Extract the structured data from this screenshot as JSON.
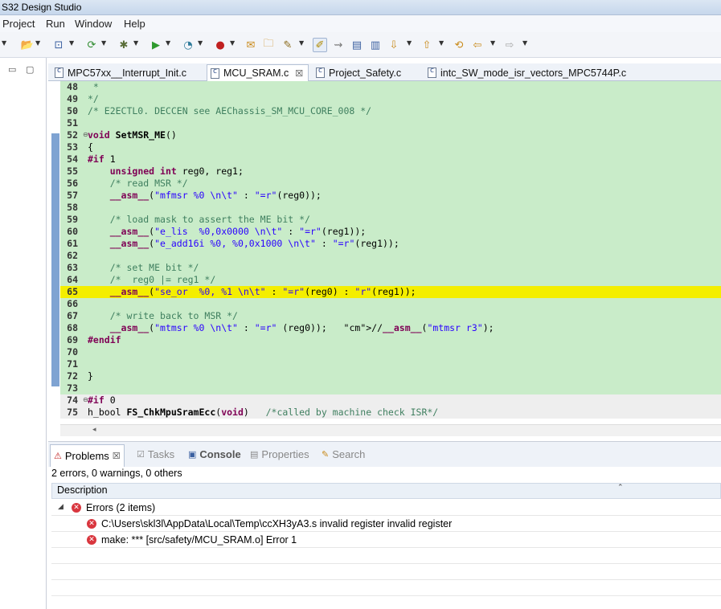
{
  "window": {
    "title": "S32 Design Studio"
  },
  "menu": [
    "Project",
    "Run",
    "Window",
    "Help"
  ],
  "toolbar_icons": [
    "new-file-icon",
    "open-folder-icon",
    "new-class-icon",
    "refresh-icon",
    "debug-icon",
    "run-icon",
    "profile-icon",
    "stop-icon",
    "open-type-icon",
    "folder-icon",
    "pen-icon",
    "highlight-icon",
    "link-icon",
    "column-icon",
    "next-annotation-icon",
    "prev-annotation-icon",
    "back-icon",
    "forward-icon"
  ],
  "tabs": [
    {
      "label": "MPC57xx__Interrupt_Init.c",
      "active": false
    },
    {
      "label": "MCU_SRAM.c",
      "active": true,
      "close": "☒"
    },
    {
      "label": "Project_Safety.c",
      "active": false
    },
    {
      "label": "intc_SW_mode_isr_vectors_MPC5744P.c",
      "active": false
    }
  ],
  "code_lines": [
    {
      "n": "48",
      "t": " *"
    },
    {
      "n": "49",
      "t": "*/"
    },
    {
      "n": "50",
      "t": "/* E2ECTL0. DECCEN see AEChassis_SM_MCU_CORE_008 */"
    },
    {
      "n": "51",
      "t": ""
    },
    {
      "n": "52",
      "t": "void SetMSR_ME()"
    },
    {
      "n": "53",
      "t": "{"
    },
    {
      "n": "54",
      "t": "#if 1"
    },
    {
      "n": "55",
      "t": "    unsigned int reg0, reg1;"
    },
    {
      "n": "56",
      "t": "    /* read MSR */"
    },
    {
      "n": "57",
      "t": "    __asm__(\"mfmsr %0 \\n\\t\" : \"=r\"(reg0));"
    },
    {
      "n": "58",
      "t": ""
    },
    {
      "n": "59",
      "t": "    /* load mask to assert the ME bit */"
    },
    {
      "n": "60",
      "t": "    __asm__(\"e_lis  %0,0x0000 \\n\\t\" : \"=r\"(reg1));"
    },
    {
      "n": "61",
      "t": "    __asm__(\"e_add16i %0, %0,0x1000 \\n\\t\" : \"=r\"(reg1));"
    },
    {
      "n": "62",
      "t": ""
    },
    {
      "n": "63",
      "t": "    /* set ME bit */"
    },
    {
      "n": "64",
      "t": "    /*  reg0 |= reg1 */"
    },
    {
      "n": "65",
      "t": "    __asm__(\"se_or  %0, %1 \\n\\t\" : \"=r\"(reg0) : \"r\"(reg1));"
    },
    {
      "n": "66",
      "t": ""
    },
    {
      "n": "67",
      "t": "    /* write back to MSR */"
    },
    {
      "n": "68",
      "t": "    __asm__(\"mtmsr %0 \\n\\t\" : \"=r\" (reg0));   //__asm__(\"mtmsr r3\");"
    },
    {
      "n": "69",
      "t": "#endif"
    },
    {
      "n": "70",
      "t": ""
    },
    {
      "n": "71",
      "t": ""
    },
    {
      "n": "72",
      "t": "}"
    },
    {
      "n": "73",
      "t": ""
    },
    {
      "n": "74",
      "t": "#if 0"
    },
    {
      "n": "75",
      "t": "h_bool FS_ChkMpuSramEcc(void)   /*called by machine check ISR*/"
    }
  ],
  "problems": {
    "tabs": [
      "Problems",
      "Tasks",
      "Console",
      "Properties",
      "Search"
    ],
    "summary": "2 errors, 0 warnings, 0 others",
    "column": "Description",
    "group": "Errors (2 items)",
    "items": [
      "C:\\Users\\skl3l\\AppData\\Local\\Temp\\ccXH3yA3.s invalid register invalid register",
      "make: *** [src/safety/MCU_SRAM.o] Error 1"
    ]
  },
  "colors": {
    "code_bg": "#c9ecc9",
    "highlight": "#f4ee00",
    "keyword": "#7f0055",
    "comment": "#3f7f5f",
    "string": "#2a00ff"
  }
}
